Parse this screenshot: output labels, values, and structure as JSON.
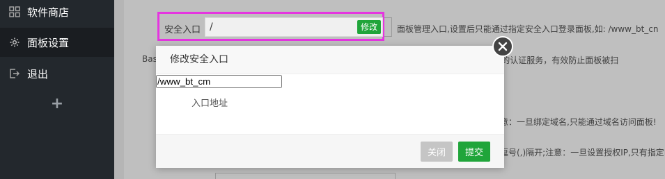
{
  "sidebar": {
    "items": [
      {
        "label": "软件商店",
        "icon": "grid-icon"
      },
      {
        "label": "面板设置",
        "icon": "gear-icon"
      },
      {
        "label": "退出",
        "icon": "logout-icon"
      }
    ],
    "add_label": "+"
  },
  "settings": {
    "entry_label": "安全入口",
    "entry_value": "/",
    "edit_label": "修改",
    "entry_desc": "面板管理入口,设置后只能通过指定安全入口登录面板,如: /www_bt_cn",
    "basic_label_partial": "Bas",
    "basic_desc_partial": "th的认证服务，有效防止面板被扫",
    "domain_desc_partial": "意：一旦绑定域名,只能通过域名访问面板!",
    "ip_desc_partial": "逗号(,)隔开;注意：一旦设置授权IP,只有指定I"
  },
  "modal": {
    "title": "修改安全入口",
    "field_label": "入口地址",
    "field_value": "/www_bt_cm",
    "close_label": "关闭",
    "submit_label": "提交"
  },
  "colors": {
    "sidebar_bg": "#23282d",
    "accent_green": "#20a53a",
    "highlight": "#e535e0"
  }
}
